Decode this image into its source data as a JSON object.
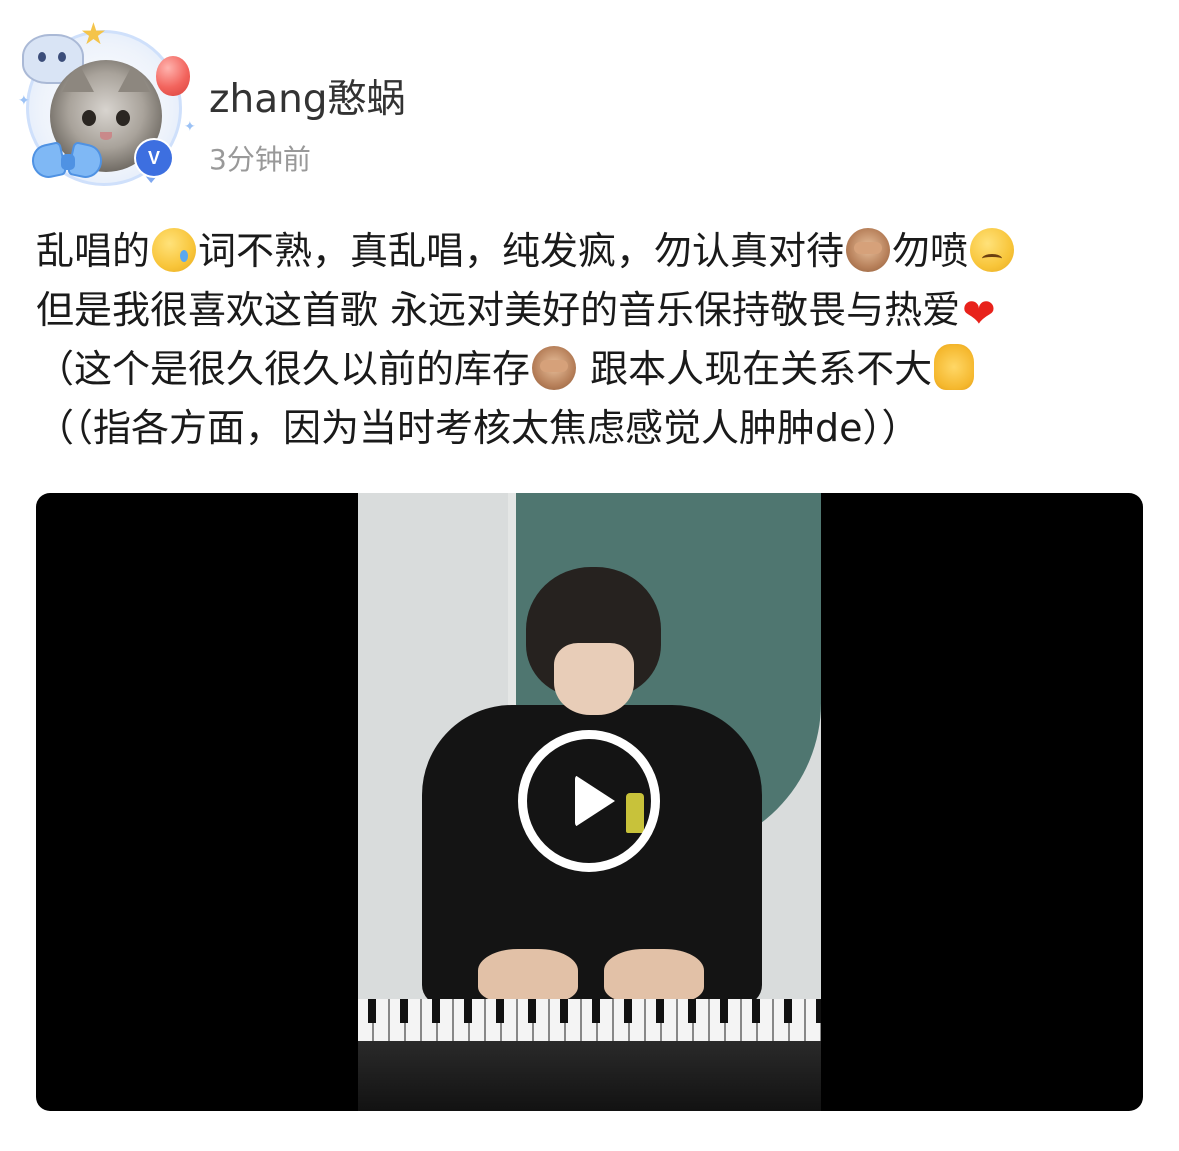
{
  "post": {
    "author": {
      "username": "zhang憨蜗",
      "timestamp": "3分钟前",
      "avatar_icon": "cat-avatar",
      "verified_icon": "verified-badge-icon",
      "verified_letter": "V",
      "accent_color": "#3d6fe0"
    },
    "text_lines": [
      {
        "segments": [
          "乱唱的",
          "词不熟，真乱唱，纯发疯，勿认真对待",
          "勿喷",
          ""
        ],
        "emojis": [
          "crying-face-emoji",
          "see-no-evil-monkey-emoji",
          "confounded-face-emoji"
        ]
      },
      {
        "segments": [
          "但是我很喜欢这首歌 永远对美好的音乐保持敬畏与热爱",
          ""
        ],
        "emojis": [
          "red-heart-emoji"
        ]
      },
      {
        "segments": [
          "（这个是很久很久以前的库存",
          " 跟本人现在关系不大",
          ""
        ],
        "emojis": [
          "see-no-evil-monkey-emoji",
          "raised-hand-emoji"
        ]
      },
      {
        "segments": [
          "（（指各方面，因为当时考核太焦虑感觉人肿肿de））"
        ],
        "emojis": []
      }
    ],
    "video": {
      "play_icon": "play-icon",
      "background_color": "#000000"
    }
  }
}
